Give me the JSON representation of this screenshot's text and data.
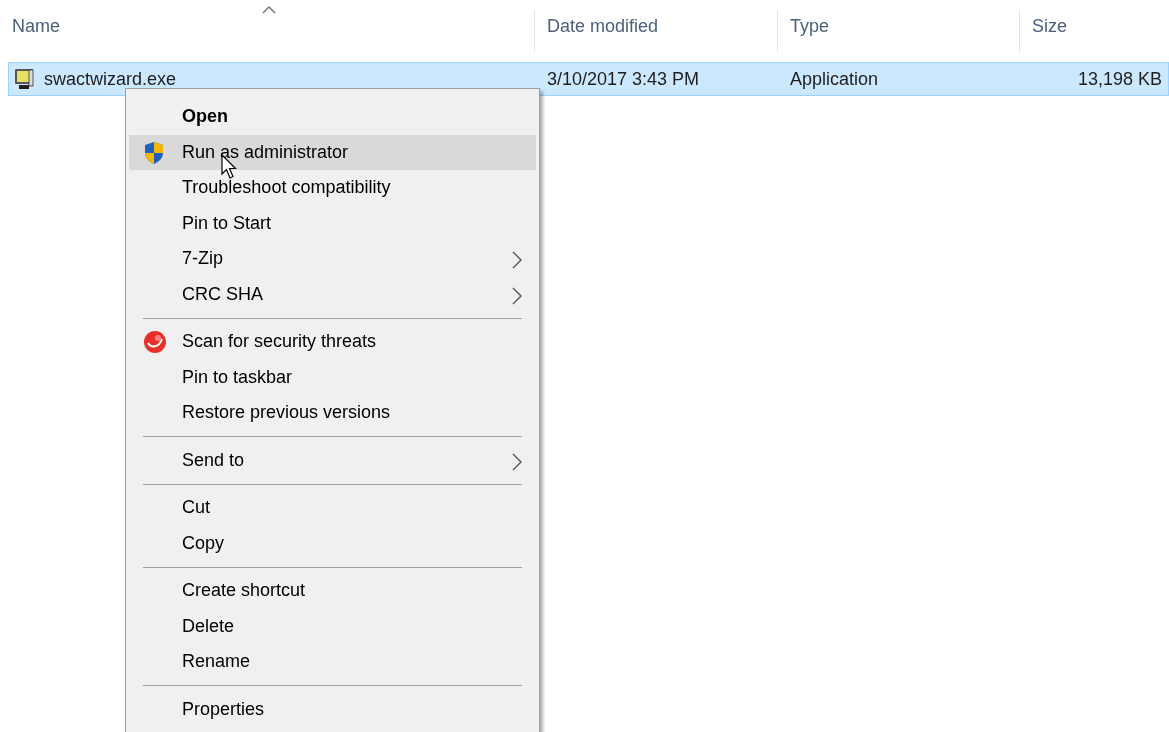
{
  "columns": [
    {
      "label": "Name",
      "sorted": true
    },
    {
      "label": "Date modified",
      "sorted": false
    },
    {
      "label": "Type",
      "sorted": false
    },
    {
      "label": "Size",
      "sorted": false
    }
  ],
  "files": [
    {
      "name": "swactwizard.exe",
      "date_modified": "3/10/2017 3:43 PM",
      "type": "Application",
      "size": "13,198 KB",
      "selected": true
    }
  ],
  "context_menu": [
    {
      "kind": "item",
      "label": "Open",
      "default": true,
      "selected": false
    },
    {
      "kind": "shield",
      "label": "Run as administrator",
      "selected": true
    },
    {
      "kind": "item",
      "label": "Troubleshoot compatibility",
      "selected": false
    },
    {
      "kind": "item",
      "label": "Pin to Start",
      "selected": false
    },
    {
      "kind": "item",
      "label": "7-Zip",
      "submenu": true,
      "selected": false
    },
    {
      "kind": "item",
      "label": "CRC SHA",
      "submenu": true,
      "selected": false
    },
    {
      "kind": "separator"
    },
    {
      "kind": "scan",
      "label": "Scan for security threats",
      "selected": false
    },
    {
      "kind": "item",
      "label": "Pin to taskbar",
      "selected": false
    },
    {
      "kind": "item",
      "label": "Restore previous versions",
      "selected": false
    },
    {
      "kind": "separator"
    },
    {
      "kind": "item",
      "label": "Send to",
      "submenu": true,
      "selected": false
    },
    {
      "kind": "separator"
    },
    {
      "kind": "item",
      "label": "Cut",
      "selected": false
    },
    {
      "kind": "item",
      "label": "Copy",
      "selected": false
    },
    {
      "kind": "separator"
    },
    {
      "kind": "item",
      "label": "Create shortcut",
      "selected": false
    },
    {
      "kind": "item",
      "label": "Delete",
      "selected": false
    },
    {
      "kind": "item",
      "label": "Rename",
      "selected": false
    },
    {
      "kind": "separator"
    },
    {
      "kind": "item",
      "label": "Properties",
      "selected": false
    }
  ]
}
